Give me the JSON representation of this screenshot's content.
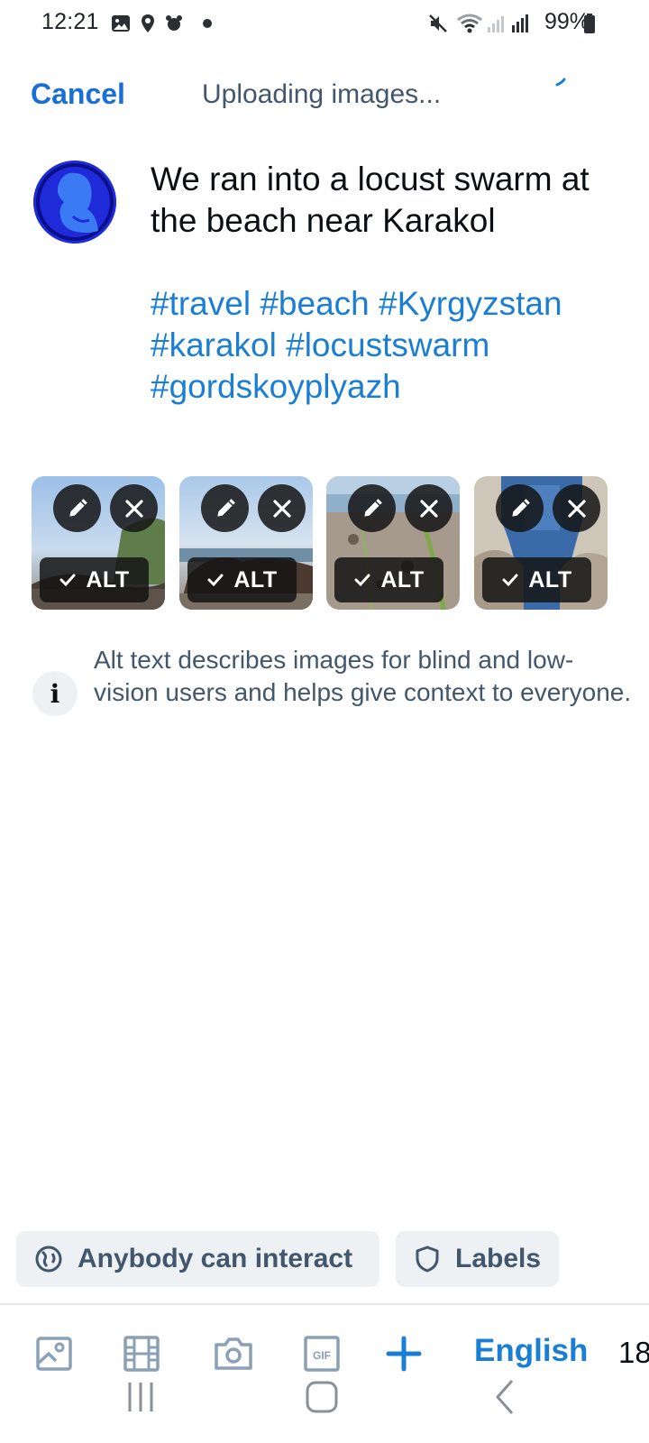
{
  "status_bar": {
    "time": "12:21",
    "battery": "99%"
  },
  "header": {
    "cancel_label": "Cancel",
    "status_text": "Uploading images..."
  },
  "post": {
    "text": "We ran into a locust swarm at the beach near Karakol",
    "hashtags": "#travel #beach #Kyrgyzstan #karakol #locustswarm #gordskoyplyazh"
  },
  "images": [
    {
      "alt_label": "ALT"
    },
    {
      "alt_label": "ALT"
    },
    {
      "alt_label": "ALT"
    },
    {
      "alt_label": "ALT"
    }
  ],
  "info": {
    "text": "Alt text describes images for blind and low-vision users and helps give context to everyone."
  },
  "controls": {
    "interaction_label": "Anybody can interact",
    "labels_label": "Labels"
  },
  "toolbar": {
    "language": "English",
    "char_count": "18"
  },
  "colors": {
    "accent": "#1a7fd4",
    "cancel": "#1a6fd6",
    "muted_text": "#42576c",
    "pill_bg": "#eef1f4"
  },
  "icons": {
    "toolbar": [
      "gallery-icon",
      "video-icon",
      "camera-icon",
      "gif-icon",
      "add-post-icon"
    ],
    "thumb_actions": [
      "pencil-icon",
      "close-icon",
      "check-icon"
    ]
  }
}
